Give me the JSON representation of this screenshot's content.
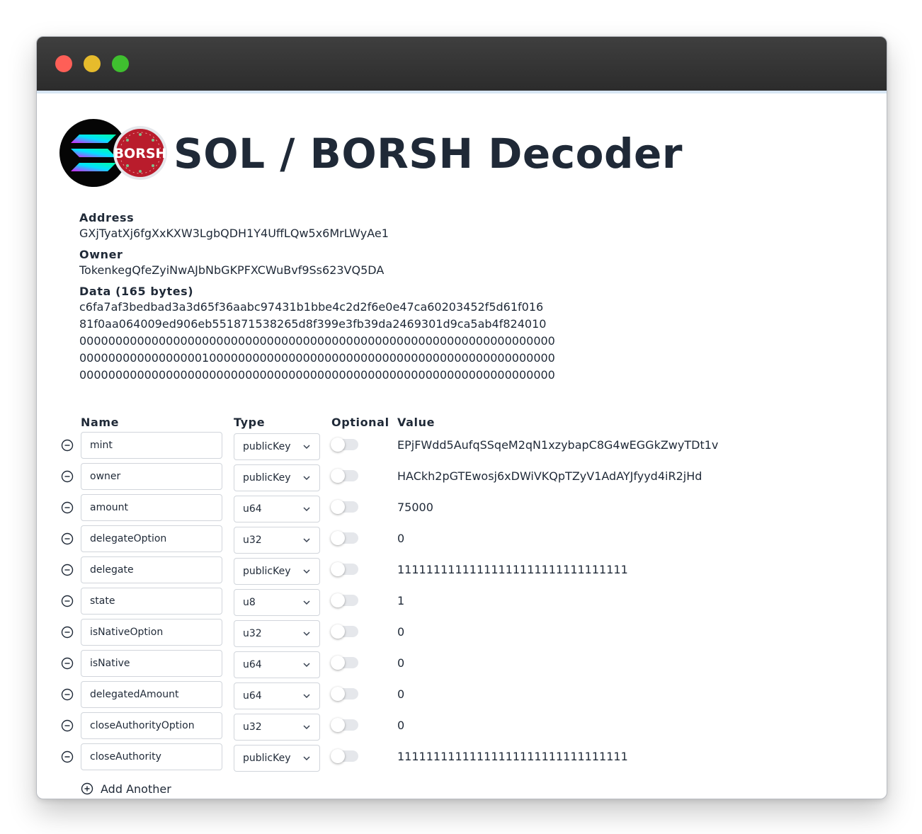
{
  "app": {
    "title": "SOL / BORSH Decoder",
    "logos": [
      "solana-logo",
      "borsh-logo"
    ],
    "borsh_logo_text": "BORSH"
  },
  "account": {
    "address_label": "Address",
    "address": "GXjTyatXj6fgXxKXW3LgbQDH1Y4UffLQw5x6MrLWyAe1",
    "owner_label": "Owner",
    "owner": "TokenkegQfeZyiNwAJbNbGKPFXCWuBvf9Ss623VQ5DA",
    "data_label": "Data (165 bytes)",
    "data_lines": [
      "c6fa7af3bedbad3a3d65f36aabc97431b1bbe4c2d2f6e0e47ca60203452f5d61f016",
      "81f0aa064009ed906eb551871538265d8f399e3fb39da2469301d9ca5ab4f824010",
      "000000000000000000000000000000000000000000000000000000000000000000",
      "000000000000000001000000000000000000000000000000000000000000000000",
      "000000000000000000000000000000000000000000000000000000000000000000"
    ]
  },
  "table": {
    "headers": {
      "name": "Name",
      "type": "Type",
      "optional": "Optional",
      "value": "Value"
    },
    "rows": [
      {
        "name": "mint",
        "type": "publicKey",
        "optional": false,
        "value": "EPjFWdd5AufqSSqeM2qN1xzybapC8G4wEGGkZwyTDt1v"
      },
      {
        "name": "owner",
        "type": "publicKey",
        "optional": false,
        "value": "HACkh2pGTEwosj6xDWiVKQpTZyV1AdAYJfyyd4iR2jHd"
      },
      {
        "name": "amount",
        "type": "u64",
        "optional": false,
        "value": "75000"
      },
      {
        "name": "delegateOption",
        "type": "u32",
        "optional": false,
        "value": "0"
      },
      {
        "name": "delegate",
        "type": "publicKey",
        "optional": false,
        "value": "11111111111111111111111111111111"
      },
      {
        "name": "state",
        "type": "u8",
        "optional": false,
        "value": "1"
      },
      {
        "name": "isNativeOption",
        "type": "u32",
        "optional": false,
        "value": "0"
      },
      {
        "name": "isNative",
        "type": "u64",
        "optional": false,
        "value": "0"
      },
      {
        "name": "delegatedAmount",
        "type": "u64",
        "optional": false,
        "value": "0"
      },
      {
        "name": "closeAuthorityOption",
        "type": "u32",
        "optional": false,
        "value": "0"
      },
      {
        "name": "closeAuthority",
        "type": "publicKey",
        "optional": false,
        "value": "11111111111111111111111111111111"
      }
    ],
    "add_label": "Add Another"
  },
  "colors": {
    "titlebar": "#2e2e2e",
    "close": "#fe5f57",
    "minimize": "#e6bb2c",
    "maximize": "#3fbf2f",
    "text": "#1f2937",
    "borsh_red": "#b91c2c",
    "solana_gradient": [
      "#00ffa3",
      "#03e1ff",
      "#dc1fff"
    ]
  }
}
